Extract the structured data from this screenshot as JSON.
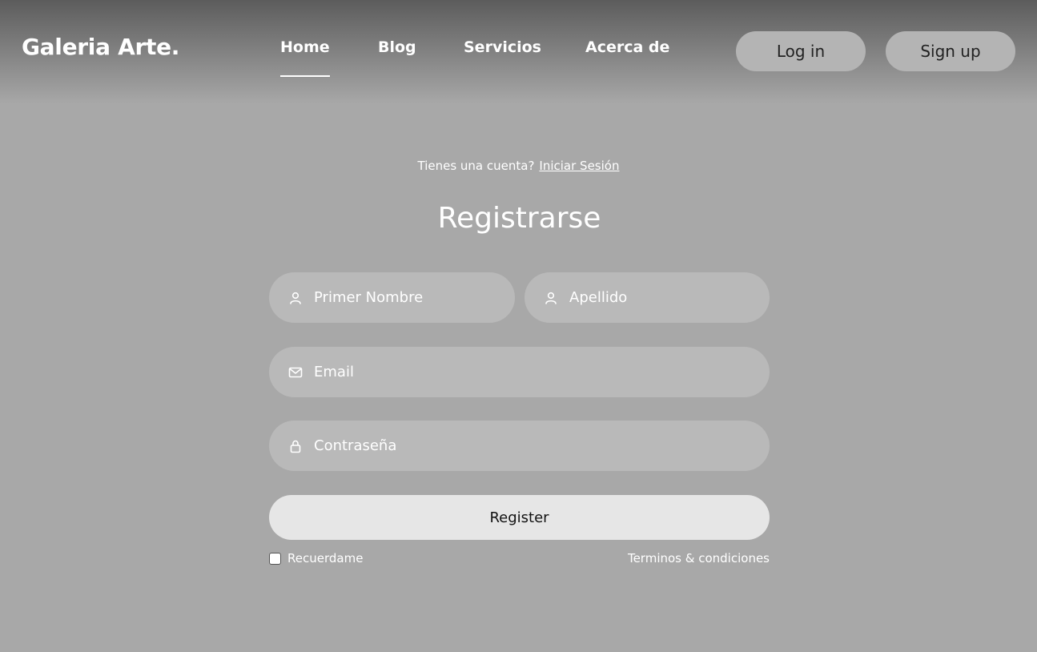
{
  "header": {
    "logo": "Galeria Arte.",
    "nav": [
      {
        "label": "Home",
        "active": true
      },
      {
        "label": "Blog",
        "active": false
      },
      {
        "label": "Servicios",
        "active": false
      },
      {
        "label": "Acerca de",
        "active": false
      }
    ],
    "login_label": "Log in",
    "signup_label": "Sign up"
  },
  "form": {
    "have_account_text": "Tienes una cuenta?",
    "login_link": "Iniciar Sesión",
    "title": "Registrarse",
    "first_name_placeholder": "Primer Nombre",
    "last_name_placeholder": "Apellido",
    "email_placeholder": "Email",
    "password_placeholder": "Contraseña",
    "register_label": "Register",
    "remember_label": "Recuerdame",
    "remember_checked": false,
    "terms_label": "Terminos & condiciones",
    "icons": {
      "first_name": "user-icon",
      "last_name": "user-icon",
      "email": "mail-icon",
      "password": "lock-icon"
    }
  },
  "colors": {
    "background": "#a8a8a8",
    "field": "#b9b9b9",
    "button": "#e6e6e6"
  }
}
